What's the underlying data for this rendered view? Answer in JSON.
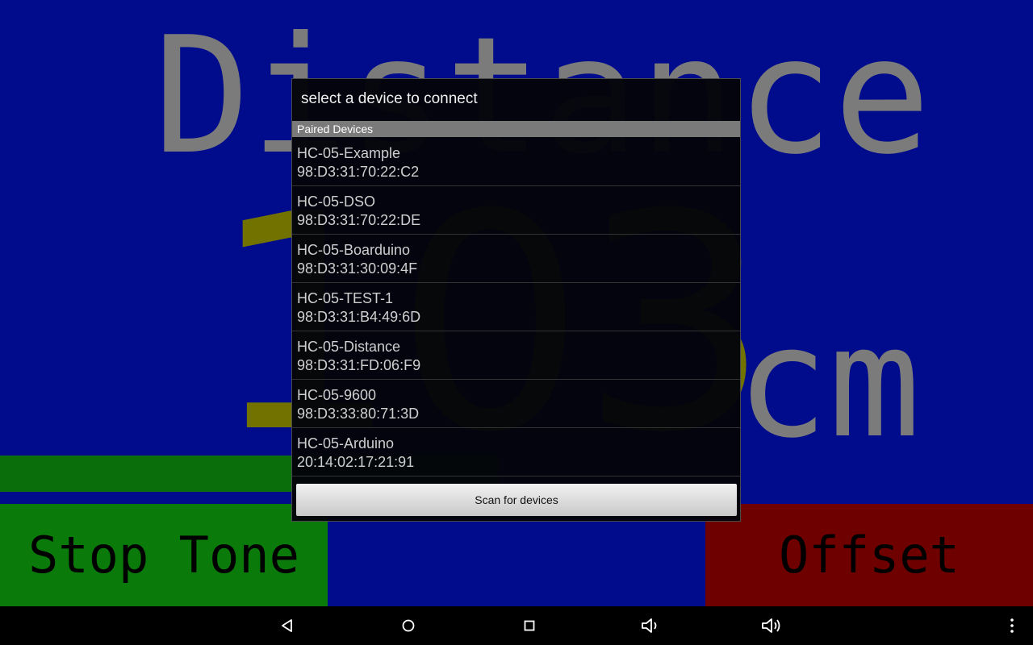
{
  "background": {
    "title": "Distance",
    "value": "103",
    "unit": "cm"
  },
  "buttons": {
    "stop_tone": "Stop Tone",
    "offset": "Offset"
  },
  "dialog": {
    "title": "select a device to connect",
    "section_header": "Paired Devices",
    "devices": [
      {
        "name": "HC-05-Example",
        "address": "98:D3:31:70:22:C2"
      },
      {
        "name": "HC-05-DSO",
        "address": "98:D3:31:70:22:DE"
      },
      {
        "name": "HC-05-Boarduino",
        "address": "98:D3:31:30:09:4F"
      },
      {
        "name": "HC-05-TEST-1",
        "address": "98:D3:31:B4:49:6D"
      },
      {
        "name": "HC-05-Distance",
        "address": "98:D3:31:FD:06:F9"
      },
      {
        "name": "HC-05-9600",
        "address": "98:D3:33:80:71:3D"
      },
      {
        "name": "HC-05-Arduino",
        "address": "20:14:02:17:21:91"
      }
    ],
    "scan_label": "Scan for devices"
  },
  "navbar": {
    "icons": [
      "back-icon",
      "home-icon",
      "recents-icon",
      "volume-down-icon",
      "volume-up-icon",
      "menu-icon"
    ]
  },
  "colors": {
    "background": "#000c8c",
    "stop_button": "#0a7a0a",
    "offset_button": "#6e0000",
    "value_text": "#727200"
  }
}
